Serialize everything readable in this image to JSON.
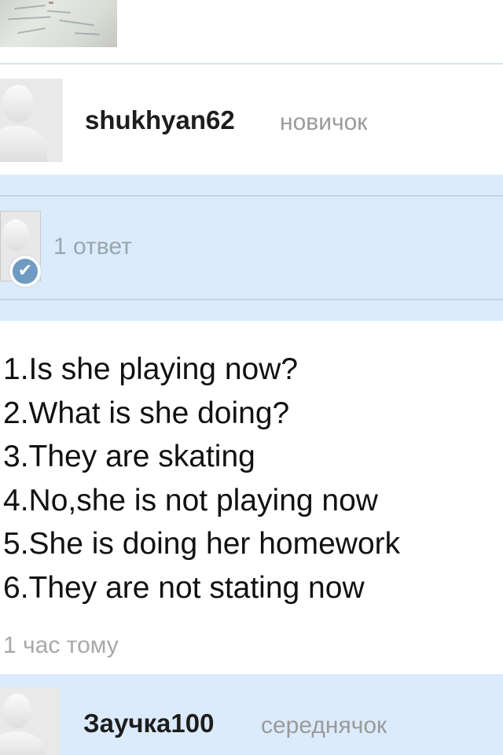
{
  "question_author": {
    "username": "shukhyan62",
    "rank": "новичок"
  },
  "answer": {
    "count_label": "1 ответ",
    "lines": [
      "1.Is she playing now?",
      "2.What is she doing?",
      "3.They are skating",
      "4.No,she is not playing now",
      "5.She is doing her homework",
      "6.They are not stating now"
    ],
    "time_ago": "1 час тому"
  },
  "next_answer_author": {
    "username": "Заучка100",
    "rank": "середнячок"
  },
  "colors": {
    "panel_bg": "#dcebfb",
    "rank_text": "#9a9a9a",
    "verified_badge": "#6f9bc2"
  }
}
